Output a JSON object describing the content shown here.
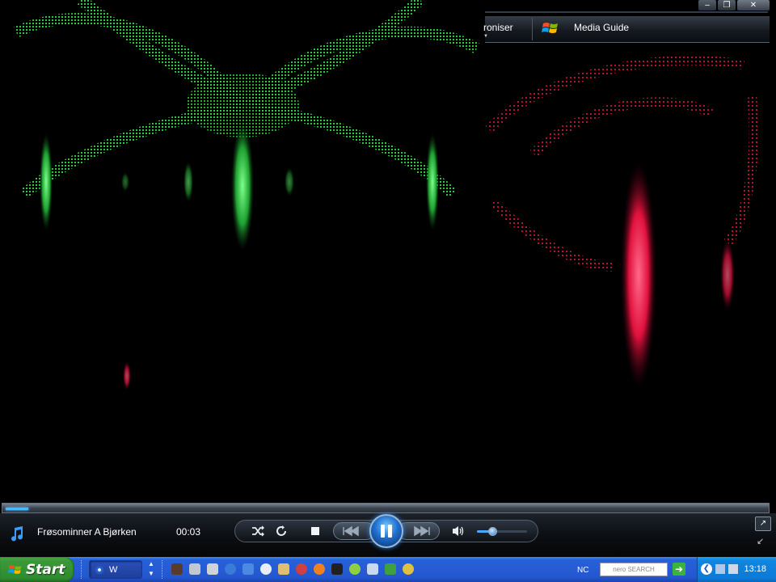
{
  "window": {
    "minimize_icon": "minimize-icon",
    "restore_icon": "restore-icon",
    "close_icon": "close-icon"
  },
  "tabs": {
    "sync_label": "roniser",
    "guide_label": "Media Guide"
  },
  "playback": {
    "track_title": "Frøsominner A Bjørken",
    "elapsed": "00:03",
    "seek_progress": 0.03,
    "volume": 0.3
  },
  "controls": {
    "shuffle_icon": "shuffle-icon",
    "repeat_icon": "repeat-icon",
    "stop_icon": "stop-icon",
    "previous_icon": "previous-icon",
    "pause_icon": "pause-icon",
    "next_icon": "next-icon",
    "mute_icon": "speaker-icon"
  },
  "taskbar": {
    "start_label": "Start",
    "task_label": "W",
    "nc_label": "NC",
    "search_label": "nero SEARCH",
    "clock": "13:18"
  },
  "colors": {
    "viz_green": "#2ecc40",
    "viz_red": "#ff2050",
    "accent_blue": "#2a8cff"
  }
}
